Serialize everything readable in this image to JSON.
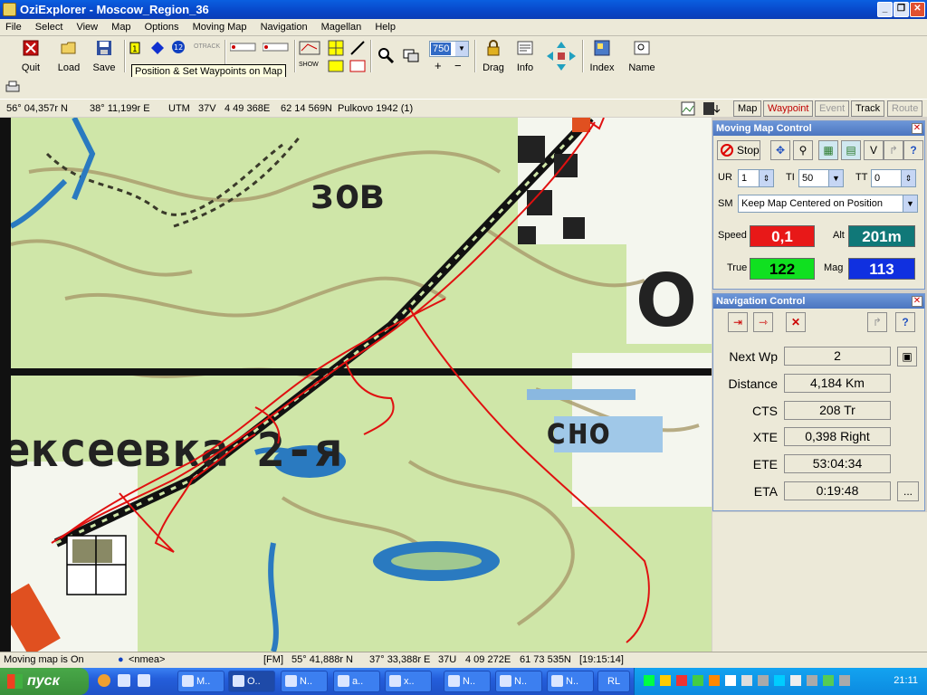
{
  "window": {
    "title": "OziExplorer - Moscow_Region_36",
    "minimize_icon": "minimize-icon",
    "maximize_icon": "maximize-icon",
    "close_icon": "close-icon"
  },
  "menu": [
    "File",
    "Select",
    "View",
    "Map",
    "Options",
    "Moving Map",
    "Navigation",
    "Magellan",
    "Help"
  ],
  "toolbar": {
    "quit": "Quit",
    "load": "Load",
    "save": "Save",
    "zoom_value": "750",
    "zoom_in": "+",
    "zoom_out": "−",
    "drag": "Drag",
    "info": "Info",
    "index": "Index",
    "name": "Name",
    "otrack": "OTRACK",
    "show": "SHOW",
    "tooltip": "Position & Set Waypoints on Map"
  },
  "position_bar": {
    "lat": "56° 04,357r N",
    "lon": "38° 11,199r E",
    "utm_label": "UTM",
    "utm_zone": "37V",
    "easting": "4 49 368E",
    "northing": "62 14 569N",
    "datum": "Pulkovo 1942 (1)",
    "segments": [
      "Map",
      "Waypoint",
      "Event",
      "Track",
      "Route"
    ]
  },
  "map": {
    "labels": [
      "зов",
      "ексеевка 2-я",
      "О",
      "сно"
    ]
  },
  "moving_map": {
    "title": "Moving Map Control",
    "stop_label": "Stop",
    "v_label": "V",
    "ur_label": "UR",
    "ur_value": "1",
    "ti_label": "TI",
    "ti_value": "50",
    "tt_label": "TT",
    "tt_value": "0",
    "sm_label": "SM",
    "sm_value": "Keep Map Centered on Position",
    "speed_label": "Speed",
    "speed_value": "0,1",
    "alt_label": "Alt",
    "alt_value": "201m",
    "true_label": "True",
    "true_value": "122",
    "mag_label": "Mag",
    "mag_value": "113",
    "colors": {
      "speed": "#e81818",
      "alt": "#107878",
      "true": "#10e020",
      "mag": "#1030e0"
    }
  },
  "nav_control": {
    "title": "Navigation Control",
    "rows": [
      {
        "label": "Next Wp",
        "value": "2"
      },
      {
        "label": "Distance",
        "value": "4,184 Km"
      },
      {
        "label": "CTS",
        "value": "208 Tr"
      },
      {
        "label": "XTE",
        "value": "0,398 Right"
      },
      {
        "label": "ETE",
        "value": "53:04:34"
      },
      {
        "label": "ETA",
        "value": "0:19:48"
      }
    ],
    "more_label": "..."
  },
  "status_bar": {
    "moving": "Moving map is On",
    "nmea": "<nmea>",
    "fm": "[FM]",
    "lat": "55° 41,888r N",
    "lon": "37° 33,388r E",
    "zone": "37U",
    "easting": "4 09 272E",
    "northing": "61 73 535N",
    "time": "[19:15:14]"
  },
  "taskbar": {
    "start": "пуск",
    "tasks": [
      "M..",
      "O..",
      "N..",
      "a..",
      "x..",
      "N..",
      "N..",
      "N..",
      "RL"
    ],
    "clock": "21:11"
  }
}
